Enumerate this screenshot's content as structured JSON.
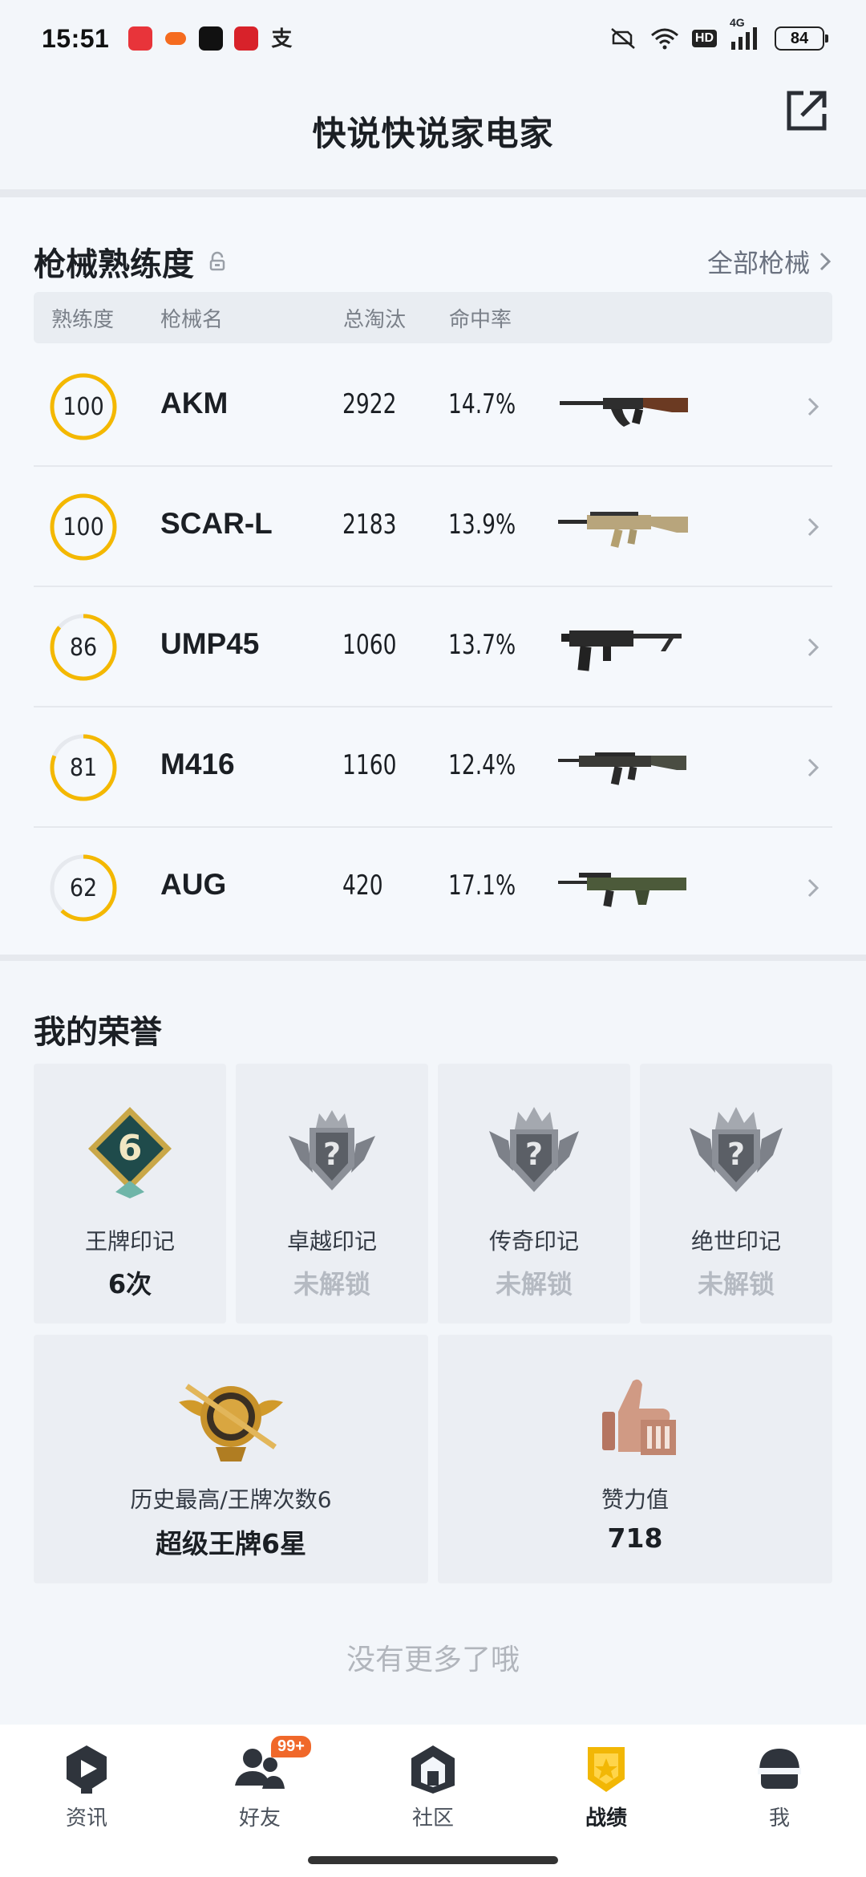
{
  "status_bar": {
    "time": "15:51",
    "pay_glyph": "支",
    "hd_label": "HD",
    "network_label": "4G",
    "battery": "84"
  },
  "header": {
    "title": "快说快说家电家",
    "share_icon": "share-out-icon"
  },
  "weapons": {
    "title": "枪械熟练度",
    "all_link": "全部枪械",
    "columns": [
      "熟练度",
      "枪械名",
      "总淘汰",
      "命中率"
    ],
    "accent_color": "#f4b800",
    "rows": [
      {
        "level": "100",
        "progress": 1.0,
        "name": "AKM",
        "kills": "2922",
        "accuracy": "14.7%",
        "gun_icon": "akm-rifle-image"
      },
      {
        "level": "100",
        "progress": 1.0,
        "name": "SCAR-L",
        "kills": "2183",
        "accuracy": "13.9%",
        "gun_icon": "scar-l-rifle-image"
      },
      {
        "level": "86",
        "progress": 0.86,
        "name": "UMP45",
        "kills": "1060",
        "accuracy": "13.7%",
        "gun_icon": "ump45-smg-image"
      },
      {
        "level": "81",
        "progress": 0.81,
        "name": "M416",
        "kills": "1160",
        "accuracy": "12.4%",
        "gun_icon": "m416-rifle-image"
      },
      {
        "level": "62",
        "progress": 0.62,
        "name": "AUG",
        "kills": "420",
        "accuracy": "17.1%",
        "gun_icon": "aug-rifle-image"
      }
    ]
  },
  "honors": {
    "title": "我的荣誉",
    "badges": [
      {
        "label": "王牌印记",
        "value": "6次",
        "locked": false,
        "badge_number": "6"
      },
      {
        "label": "卓越印记",
        "value": "未解锁",
        "locked": true
      },
      {
        "label": "传奇印记",
        "value": "未解锁",
        "locked": true
      },
      {
        "label": "绝世印记",
        "value": "未解锁",
        "locked": true
      }
    ],
    "highest": {
      "label": "历史最高/王牌次数6",
      "value": "超级王牌6星"
    },
    "likes": {
      "label": "赞力值",
      "value": "718"
    },
    "no_more": "没有更多了哦"
  },
  "bottom_nav": {
    "items": [
      {
        "label": "资讯",
        "icon": "news-play-icon",
        "active": false
      },
      {
        "label": "好友",
        "icon": "friends-icon",
        "active": false,
        "badge": "99+"
      },
      {
        "label": "社区",
        "icon": "community-house-icon",
        "active": false
      },
      {
        "label": "战绩",
        "icon": "record-badge-icon",
        "active": true
      },
      {
        "label": "我",
        "icon": "helmet-profile-icon",
        "active": false
      }
    ]
  }
}
